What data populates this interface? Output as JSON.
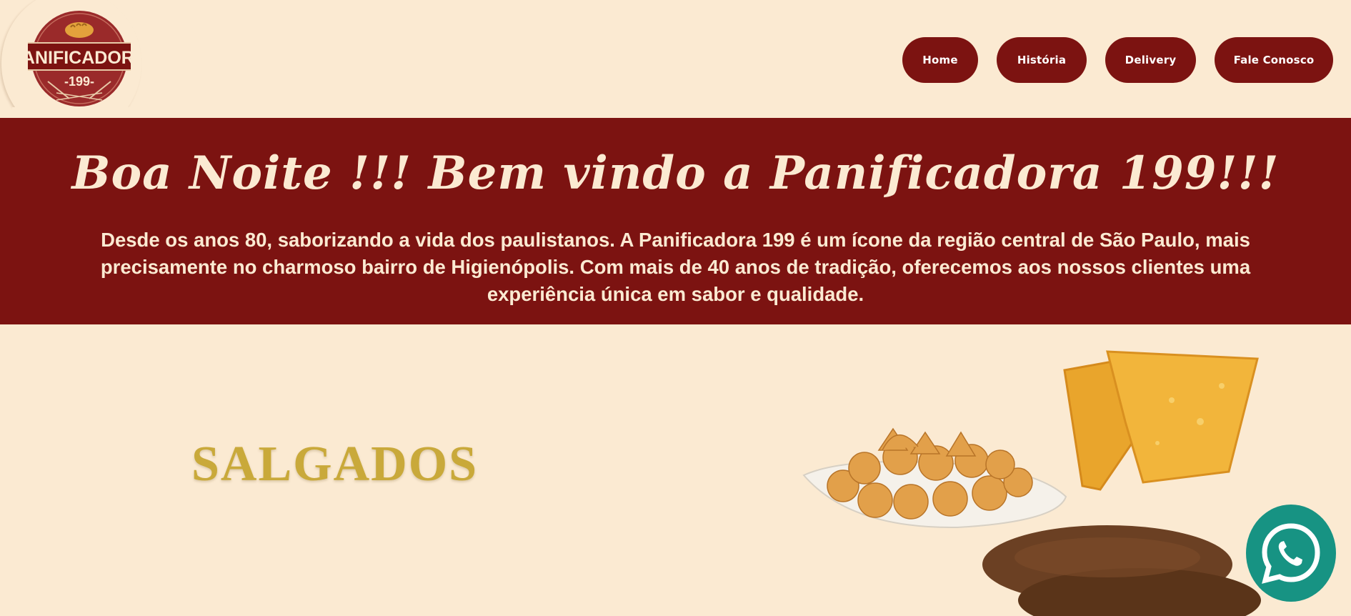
{
  "logo": {
    "line1": "PANIFICADORA",
    "line2": "-199-"
  },
  "nav": {
    "items": [
      {
        "label": "Home"
      },
      {
        "label": "História"
      },
      {
        "label": "Delivery"
      },
      {
        "label": "Fale Conosco"
      }
    ]
  },
  "banner": {
    "title": "Boa Noite !!! Bem vindo a Panificadora 199!!!",
    "text": "Desde os anos 80, saborizando a vida dos paulistanos. A Panificadora 199 é um ícone da região central de São Paulo, mais precisamente no charmoso bairro de Higienópolis. Com mais de 40 anos de tradição, oferecemos aos nossos clientes uma experiência única em sabor e qualidade."
  },
  "section": {
    "heading": "SALGADOS"
  },
  "icons": {
    "whatsapp": "whatsapp-icon",
    "bread": "bread-icon"
  },
  "colors": {
    "brand": "#7c1311",
    "background": "#fbead2",
    "gold": "#c9a93a",
    "whatsapp": "#179383"
  }
}
